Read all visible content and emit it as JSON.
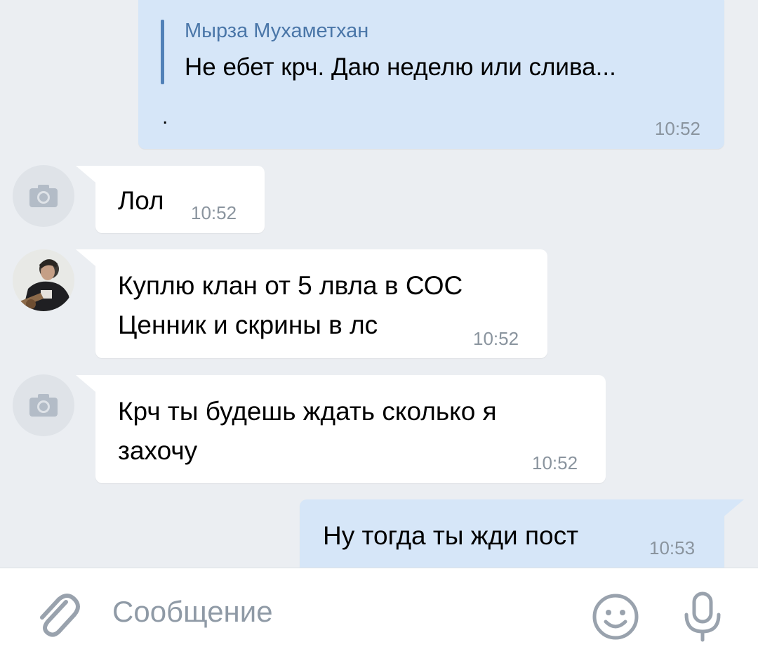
{
  "messages": [
    {
      "direction": "out",
      "reply": {
        "author": "Мырза Мухаметхан",
        "text": "Не ебет крч. Даю неделю или слива..."
      },
      "text": ".",
      "time": "10:52"
    },
    {
      "direction": "in",
      "avatar": "camera-placeholder-icon",
      "text": "Лол",
      "time": "10:52"
    },
    {
      "direction": "in",
      "avatar": "user-photo",
      "lines": [
        "Куплю клан от 5 лвла в СОС",
        "Ценник и скрины в лс"
      ],
      "time": "10:52"
    },
    {
      "direction": "in",
      "avatar": "camera-placeholder-icon",
      "lines": [
        "Крч ты будешь ждать сколько я",
        "захочу"
      ],
      "time": "10:52"
    },
    {
      "direction": "out",
      "text": "Ну тогда ты жди пост",
      "time": "10:53"
    }
  ],
  "composer": {
    "placeholder": "Сообщение",
    "attach_icon": "paperclip-icon",
    "emoji_icon": "smiley-icon",
    "voice_icon": "microphone-icon"
  },
  "colors": {
    "background": "#ebeef2",
    "incoming_bubble": "#ffffff",
    "outgoing_bubble": "#d6e6f8",
    "accent": "#4a76a8",
    "time": "#8a949e",
    "icon": "#99a2ad"
  }
}
